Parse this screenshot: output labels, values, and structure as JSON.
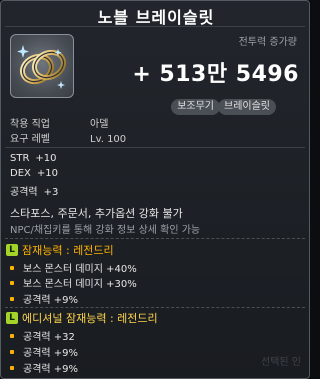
{
  "title": "노블 브레이슬릿",
  "combat_power": {
    "label": "전투력 증가량",
    "value": "+ 513만 5496"
  },
  "tags": [
    "보조무기",
    "브레이슬릿"
  ],
  "item_icon": "ring-icon",
  "requirements": [
    {
      "key": "착용 직업",
      "value": "아델"
    },
    {
      "key": "요구 레벨",
      "value": "Lv. 100"
    }
  ],
  "stats": [
    {
      "key": "STR",
      "value": "+10"
    },
    {
      "key": "DEX",
      "value": "+10"
    },
    {
      "key": "공격력",
      "value": "+3"
    }
  ],
  "notice": "스타포스, 주문서, 추가옵션 강화 불가",
  "notice_sub": "NPC/채집키를 통해 강화 정보 상세 확인 가능",
  "potential": {
    "header": "잠재능력 : 레전드리",
    "badge": "L",
    "lines": [
      "보스 몬스터 데미지 +40%",
      "보스 몬스터 데미지 +30%",
      "공격력 +9%"
    ]
  },
  "additional_potential": {
    "header": "에디셔널 잠재능력 : 레전드리",
    "badge": "L",
    "lines": [
      "공격력 +32",
      "공격력 +9%",
      "공격력 +9%"
    ]
  },
  "ghost_text": "선택된 인",
  "colors": {
    "potential_header": "#ffb300",
    "additional_header": "#ffd54a",
    "grade_badge": "#a4d42a"
  }
}
